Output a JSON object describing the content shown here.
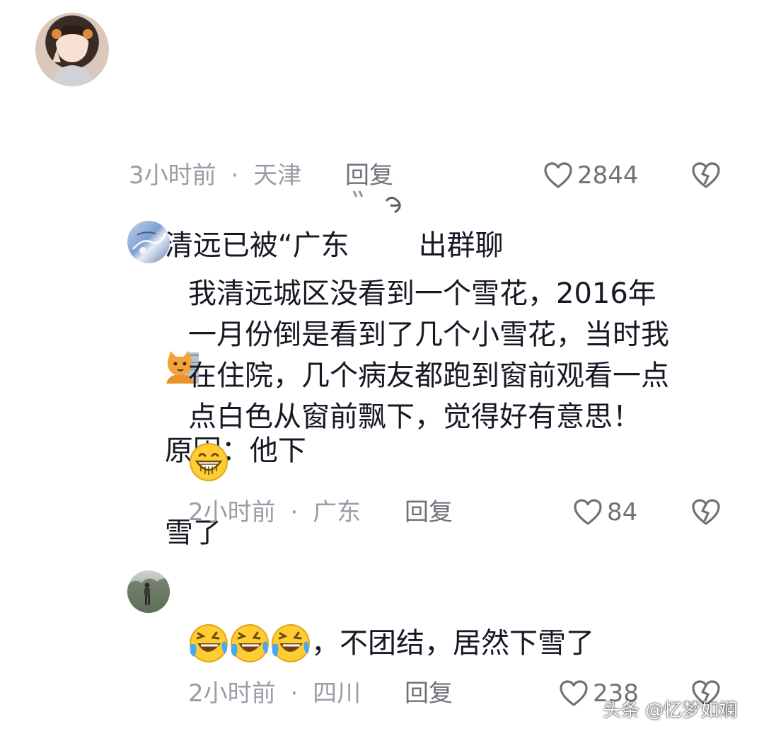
{
  "comments": [
    {
      "text_line1": "清远已被“广东",
      "text_line1_b": "出群聊",
      "text_line1_c": "原因：他下",
      "text_line2": "雪了",
      "time": "3小时前",
      "location": "天津",
      "reply_label": "回复",
      "likes": "2844"
    },
    {
      "text": "我清远城区没看到一个雪花，2016年\n一月份倒是看到了几个小雪花，当时我\n在住院，几个病友都跑到窗前观看一点\n点白色从窗前飘下，觉得好有意思！",
      "time": "2小时前",
      "location": "广东",
      "reply_label": "回复",
      "likes": "84"
    },
    {
      "text": "，不团结，居然下雪了",
      "time": "2小时前",
      "location": "四川",
      "reply_label": "回复",
      "likes": "238"
    }
  ],
  "separator": "·",
  "watermark": "头条 @忆梦如斓",
  "icons": {
    "like": "heart-outline-icon",
    "dislike": "broken-heart-icon",
    "cat_emoji": "cat-face-emoji",
    "grin_emoji": "grinning-face-emoji",
    "laugh_emoji": "tears-of-joy-emoji"
  },
  "colors": {
    "text": "#161823",
    "meta": "#9a9ca6",
    "icon": "#6f7179"
  }
}
